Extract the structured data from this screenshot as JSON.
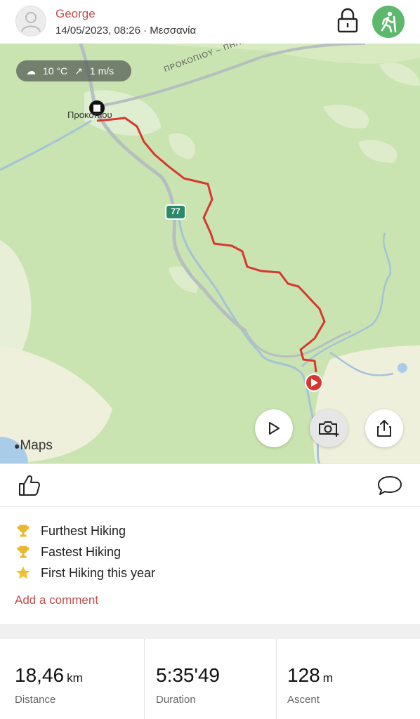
{
  "header": {
    "username": "George",
    "meta": "14/05/2023, 08:26 · Μεσσανία",
    "lock_icon": "lock-icon",
    "activity_icon": "hiking-icon",
    "activity_color": "#5cb96b"
  },
  "map": {
    "weather_temp": "10 °C",
    "weather_wind": "1 m/s",
    "road_label": "ΠΡΟΚΟΠΙΟΥ – ΠΗΛΙΟΥ",
    "route_number": "77",
    "town_label": "Προκοπιου",
    "attribution": "Maps",
    "route_color": "#d6382f",
    "buttons": [
      "play-icon",
      "camera-add-icon",
      "share-icon"
    ]
  },
  "actions": {
    "like_icon": "thumbs-up-icon",
    "comment_icon": "comment-icon"
  },
  "achievements": [
    {
      "icon": "trophy-icon",
      "label": "Furthest Hiking"
    },
    {
      "icon": "trophy-icon",
      "label": "Fastest Hiking"
    },
    {
      "icon": "star-icon",
      "label": "First Hiking this year"
    }
  ],
  "add_comment": "Add a comment",
  "stats": {
    "distance": {
      "value": "18,46",
      "unit": "km",
      "label": "Distance"
    },
    "duration": {
      "value": "5:35'49",
      "unit": "",
      "label": "Duration"
    },
    "ascent": {
      "value": "128",
      "unit": "m",
      "label": "Ascent"
    }
  }
}
